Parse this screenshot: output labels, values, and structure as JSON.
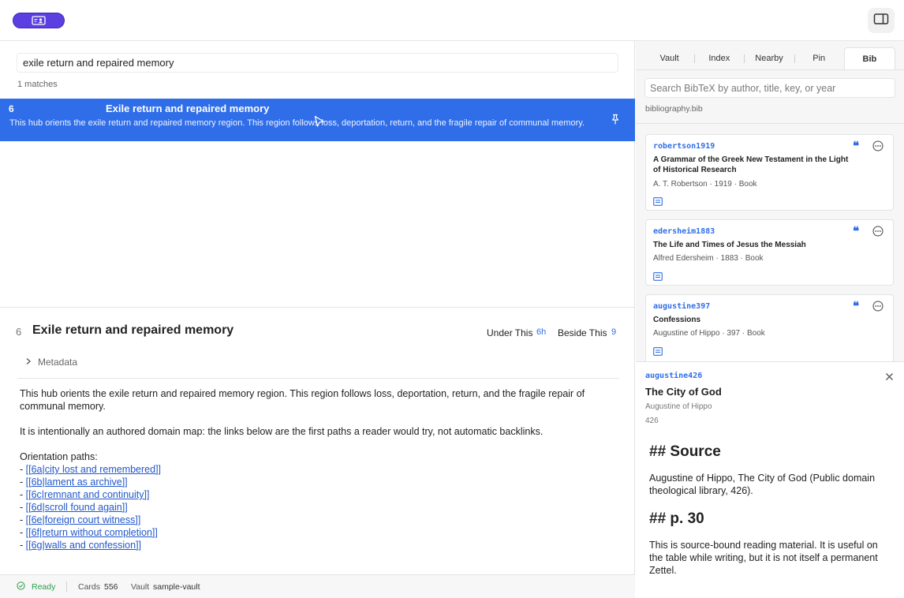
{
  "colors": {
    "accent": "#2f6ee8",
    "brand": "#5b3fe0",
    "ready": "#2a9d4a",
    "link": "#2158c9"
  },
  "search": {
    "value": "exile return and repaired memory",
    "match_count": "1 matches"
  },
  "result": {
    "number": "6",
    "title": "Exile return and repaired memory",
    "snippet": "This hub orients the exile return and repaired memory region. This region follows loss, deportation, return, and the fragile repair of communal memory."
  },
  "detail": {
    "number": "6",
    "title": "Exile return and repaired memory",
    "under_label": "Under This",
    "under_value": "6h",
    "beside_label": "Beside This",
    "beside_value": "9",
    "metadata_label": "Metadata",
    "paragraph1": "This hub orients the exile return and repaired memory region. This region follows loss, deportation, return, and the fragile repair of communal memory.",
    "paragraph2": "It is intentionally an authored domain map: the links below are the first paths a reader would try, not automatic backlinks.",
    "orientation_label": "Orientation paths:",
    "paths": [
      "[[6a|city lost and remembered]]",
      "[[6b|lament as archive]]",
      "[[6c|remnant and continuity]]",
      "[[6d|scroll found again]]",
      "[[6e|foreign court witness]]",
      "[[6f|return without completion]]",
      "[[6g|walls and confession]]"
    ]
  },
  "status": {
    "ready": "Ready",
    "cards_label": "Cards",
    "cards_value": "556",
    "vault_label": "Vault",
    "vault_value": "sample-vault"
  },
  "tabs": [
    {
      "label": "Vault"
    },
    {
      "label": "Index"
    },
    {
      "label": "Nearby"
    },
    {
      "label": "Pin"
    },
    {
      "label": "Bib",
      "active": true
    }
  ],
  "bib": {
    "search_placeholder": "Search BibTeX by author, title, key, or year",
    "file": "bibliography.bib",
    "entries": [
      {
        "key": "robertson1919",
        "title": "A Grammar of the Greek New Testament in the Light of Historical Research",
        "meta": "A. T. Robertson · 1919 · Book"
      },
      {
        "key": "edersheim1883",
        "title": "The Life and Times of Jesus the Messiah",
        "meta": "Alfred Edersheim · 1883 · Book"
      },
      {
        "key": "augustine397",
        "title": "Confessions",
        "meta": "Augustine of Hippo · 397 · Book"
      }
    ],
    "selected": {
      "key": "augustine426",
      "title": "The City of God",
      "author": "Augustine of Hippo",
      "year": "426",
      "heading1": "## Source",
      "para1": "Augustine of Hippo, The City of God (Public domain theological library, 426).",
      "heading2": "## p. 30",
      "para2": "This is source-bound reading material. It is useful on the table while writing, but it is not itself a permanent Zettel."
    }
  },
  "icons": {
    "quote_glyph": "❝",
    "app": "id-card-icon",
    "panel": "sidebar-toggle-icon",
    "pin": "pin-icon",
    "more": "more-options-icon",
    "note": "note-icon",
    "close": "close-icon",
    "chevron": "chevron-right-icon",
    "check": "check-circle-icon"
  }
}
